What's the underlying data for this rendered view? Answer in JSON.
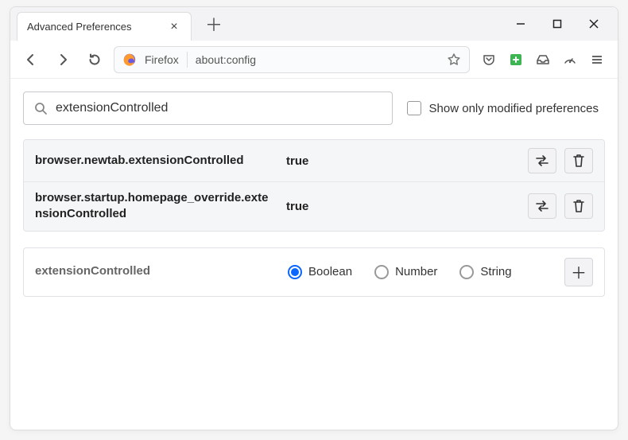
{
  "window": {
    "tab_title": "Advanced Preferences"
  },
  "navbar": {
    "identity_label": "Firefox",
    "url": "about:config"
  },
  "search": {
    "value": "extensionControlled",
    "modified_only_label": "Show only modified preferences",
    "modified_only_checked": false
  },
  "prefs": [
    {
      "name": "browser.newtab.extensionControlled",
      "value": "true"
    },
    {
      "name": "browser.startup.homepage_override.extensionControlled",
      "value": "true"
    }
  ],
  "add_row": {
    "name": "extensionControlled",
    "types": {
      "boolean": "Boolean",
      "number": "Number",
      "string": "String"
    },
    "selected": "boolean"
  }
}
